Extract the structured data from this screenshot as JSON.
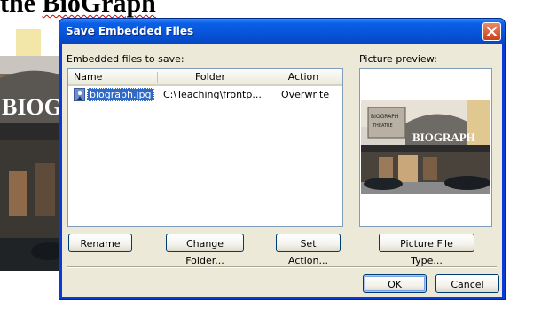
{
  "background_doc": {
    "heading_prefix": "the ",
    "heading_word": "BioGraph"
  },
  "dialog": {
    "title": "Save Embedded Files",
    "close_icon": "close-icon",
    "embedded_label": "Embedded files to save:",
    "preview_label": "Picture preview:",
    "columns": {
      "name": "Name",
      "folder": "Folder",
      "action": "Action"
    },
    "rows": [
      {
        "name": "biograph.jpg",
        "folder": "C:\\Teaching\\frontp...",
        "action": "Overwrite",
        "icon": "image-file-icon",
        "selected": true
      }
    ],
    "buttons": {
      "rename": "Rename",
      "change_folder": "Change Folder...",
      "set_action": "Set Action...",
      "picture_file_type": "Picture File Type...",
      "ok": "OK",
      "cancel": "Cancel"
    }
  },
  "colors": {
    "titlebar": "#0753d8",
    "selection": "#316ac5",
    "dialog_face": "#ece9d8",
    "close_button": "#c9421c"
  }
}
